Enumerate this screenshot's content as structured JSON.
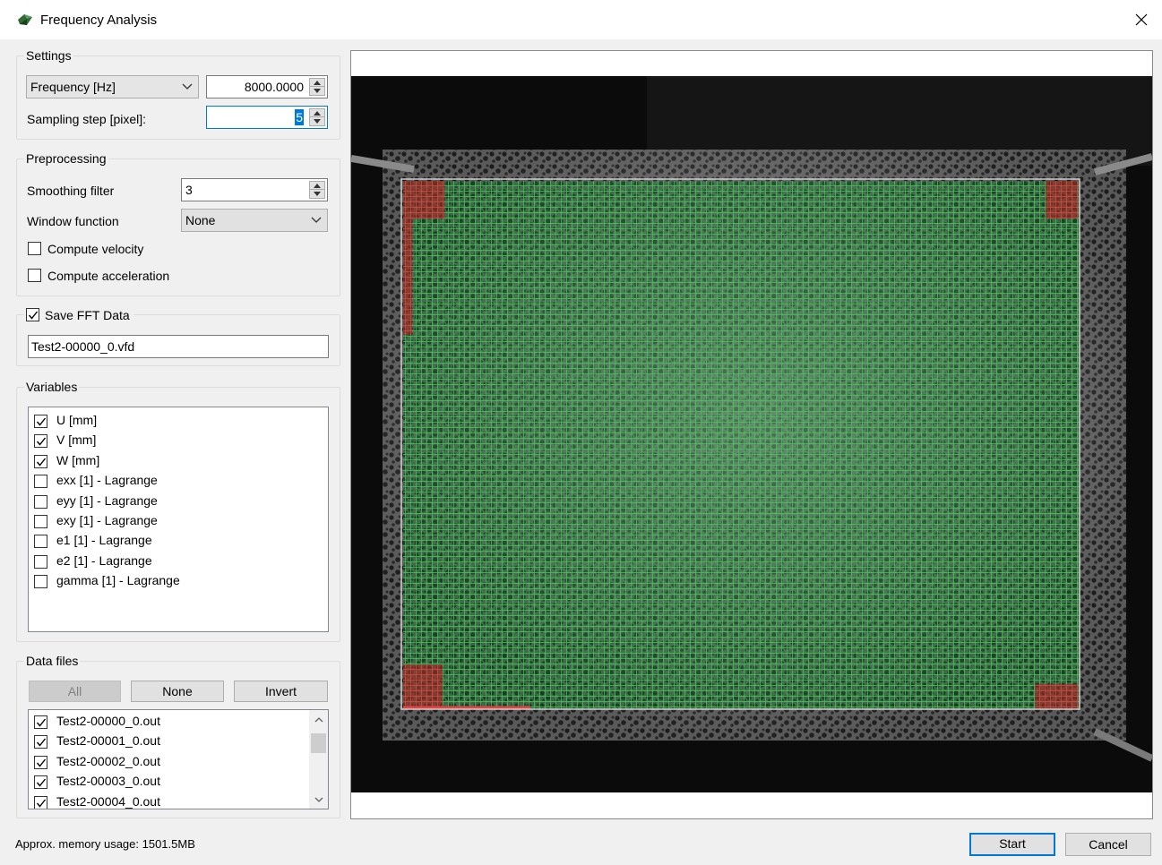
{
  "window": {
    "title": "Frequency Analysis",
    "close_glyph": "✕"
  },
  "settings": {
    "group_title": "Settings",
    "mode_combo": "Frequency [Hz]",
    "frequency_value": "8000.0000",
    "sampling_label": "Sampling step [pixel]:",
    "sampling_value": "5"
  },
  "preprocessing": {
    "group_title": "Preprocessing",
    "smoothing_label": "Smoothing filter",
    "smoothing_value": "3",
    "window_label": "Window function",
    "window_value": "None",
    "velocity_label": "Compute velocity",
    "velocity_checked": false,
    "acceleration_label": "Compute acceleration",
    "acceleration_checked": false
  },
  "save_fft": {
    "label": "Save FFT Data",
    "checked": true,
    "filename": "Test2-00000_0.vfd"
  },
  "variables": {
    "group_title": "Variables",
    "items": [
      {
        "label": "U [mm]",
        "checked": true
      },
      {
        "label": "V [mm]",
        "checked": true
      },
      {
        "label": "W [mm]",
        "checked": true
      },
      {
        "label": "exx [1] - Lagrange",
        "checked": false
      },
      {
        "label": "eyy [1] - Lagrange",
        "checked": false
      },
      {
        "label": "exy [1] - Lagrange",
        "checked": false
      },
      {
        "label": "e1 [1] - Lagrange",
        "checked": false
      },
      {
        "label": "e2 [1] - Lagrange",
        "checked": false
      },
      {
        "label": "gamma [1] - Lagrange",
        "checked": false
      }
    ]
  },
  "data_files": {
    "group_title": "Data files",
    "all_label": "All",
    "none_label": "None",
    "invert_label": "Invert",
    "items": [
      {
        "label": "Test2-00000_0.out",
        "checked": true
      },
      {
        "label": "Test2-00001_0.out",
        "checked": true
      },
      {
        "label": "Test2-00002_0.out",
        "checked": true
      },
      {
        "label": "Test2-00003_0.out",
        "checked": true
      },
      {
        "label": "Test2-00004_0.out",
        "checked": true
      }
    ]
  },
  "footer": {
    "memory_text": "Approx. memory usage: 1501.5MB",
    "start_label": "Start",
    "cancel_label": "Cancel"
  },
  "colors": {
    "accent": "#0078d7",
    "grid_green": "#3ccf4e",
    "corner_red": "#d83030"
  },
  "icons": {
    "app": "app-icon",
    "close": "close-icon",
    "dropdown": "chevron-down-icon",
    "spin": "spin-arrows-icon",
    "check": "check-icon"
  }
}
